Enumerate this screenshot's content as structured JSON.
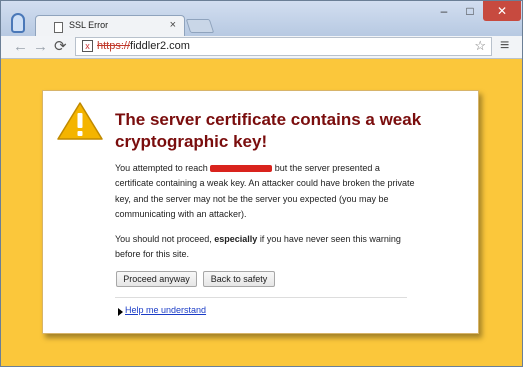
{
  "browser": {
    "tab_title": "SSL Error",
    "tab_close": "×",
    "window_controls": {
      "minimize": "–",
      "maximize": "□",
      "close": "✕"
    },
    "address": {
      "scheme": "https://",
      "host": "fiddler2.com"
    },
    "icons": {
      "profile": "profile-icon",
      "favicon": "page-icon",
      "back": "back-arrow-icon",
      "forward": "forward-arrow-icon",
      "reload": "reload-icon",
      "security": "broken-lock-icon",
      "bookmark": "star-icon",
      "menu": "hamburger-menu-icon"
    }
  },
  "page": {
    "background_color": "#fbc73b",
    "heading": "The server certificate contains a weak cryptographic key!",
    "para1_before": "You attempted to reach",
    "para1_after": "but the server presented a certificate containing a weak key. An attacker could have broken the private key, and the server may not be the server you expected (you may be communicating with an attacker).",
    "para2_before": "You should not proceed,",
    "para2_emphasis": "especially",
    "para2_after": "if you have never seen this warning before for this site.",
    "proceed_button": "Proceed anyway",
    "safety_button": "Back to safety",
    "help_link": "Help me understand",
    "warning_icon": "warning-triangle-icon"
  }
}
